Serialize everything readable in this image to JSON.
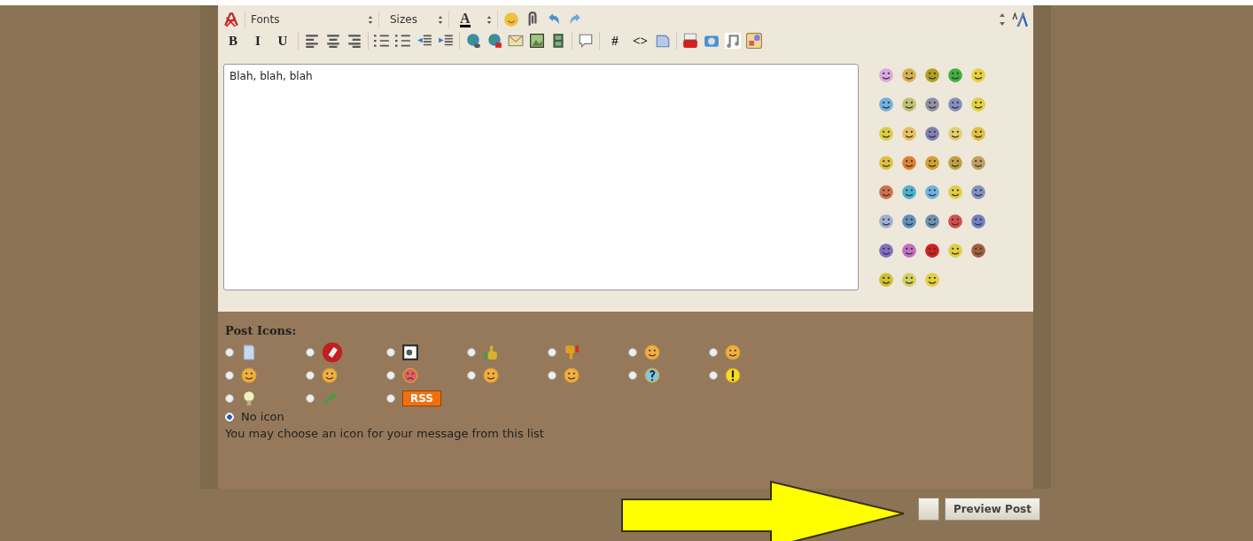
{
  "toolbar": {
    "row1": [
      {
        "kind": "font-icon"
      },
      {
        "kind": "select",
        "text": "Fonts"
      },
      {
        "kind": "select",
        "text": "Sizes"
      },
      {
        "kind": "color-select",
        "text": "A"
      },
      {
        "kind": "smiley-select"
      },
      {
        "kind": "attach-select"
      },
      {
        "kind": "undo"
      },
      {
        "kind": "redo"
      }
    ],
    "row2": [
      {
        "kind": "text",
        "text": "B"
      },
      {
        "kind": "text",
        "text": "I"
      },
      {
        "kind": "text",
        "text": "U"
      },
      {
        "kind": "sep"
      },
      {
        "kind": "align-left"
      },
      {
        "kind": "align-center"
      },
      {
        "kind": "align-right"
      },
      {
        "kind": "sep"
      },
      {
        "kind": "ordered-list"
      },
      {
        "kind": "bullet-list"
      },
      {
        "kind": "outdent"
      },
      {
        "kind": "indent"
      },
      {
        "kind": "sep"
      },
      {
        "kind": "globe-link"
      },
      {
        "kind": "globe-unlink"
      },
      {
        "kind": "envelope"
      },
      {
        "kind": "picture"
      },
      {
        "kind": "film"
      },
      {
        "kind": "sep"
      },
      {
        "kind": "speech"
      },
      {
        "kind": "sep"
      },
      {
        "kind": "text",
        "text": "#"
      },
      {
        "kind": "text",
        "text": "<>"
      },
      {
        "kind": "php-doc"
      },
      {
        "kind": "sep"
      },
      {
        "kind": "video"
      },
      {
        "kind": "camera"
      },
      {
        "kind": "music"
      },
      {
        "kind": "gallery"
      }
    ]
  },
  "editor": {
    "value": "Blah, blah, blah"
  },
  "post_icons": {
    "title": "Post Icons:",
    "options": [
      {
        "kind": "page",
        "selected": false
      },
      {
        "kind": "tag",
        "selected": false
      },
      {
        "kind": "image",
        "selected": false
      },
      {
        "kind": "thumbs-up",
        "selected": false
      },
      {
        "kind": "thumbs-down",
        "selected": false
      },
      {
        "kind": "face",
        "selected": false
      },
      {
        "kind": "face",
        "selected": false
      },
      {
        "kind": "face",
        "selected": false
      },
      {
        "kind": "face",
        "selected": false
      },
      {
        "kind": "angry-face",
        "selected": false
      },
      {
        "kind": "face",
        "selected": false
      },
      {
        "kind": "face",
        "selected": false
      },
      {
        "kind": "question",
        "selected": false
      },
      {
        "kind": "exclamation",
        "selected": false
      },
      {
        "kind": "bulb",
        "selected": false
      },
      {
        "kind": "arrow",
        "selected": false
      },
      {
        "kind": "rss",
        "text": "RSS",
        "selected": false
      }
    ],
    "none": {
      "label": "No icon",
      "selected": true
    },
    "hint": "You may choose an icon for your message from this list"
  },
  "buttons": [
    {
      "label": "Preview Post"
    }
  ]
}
